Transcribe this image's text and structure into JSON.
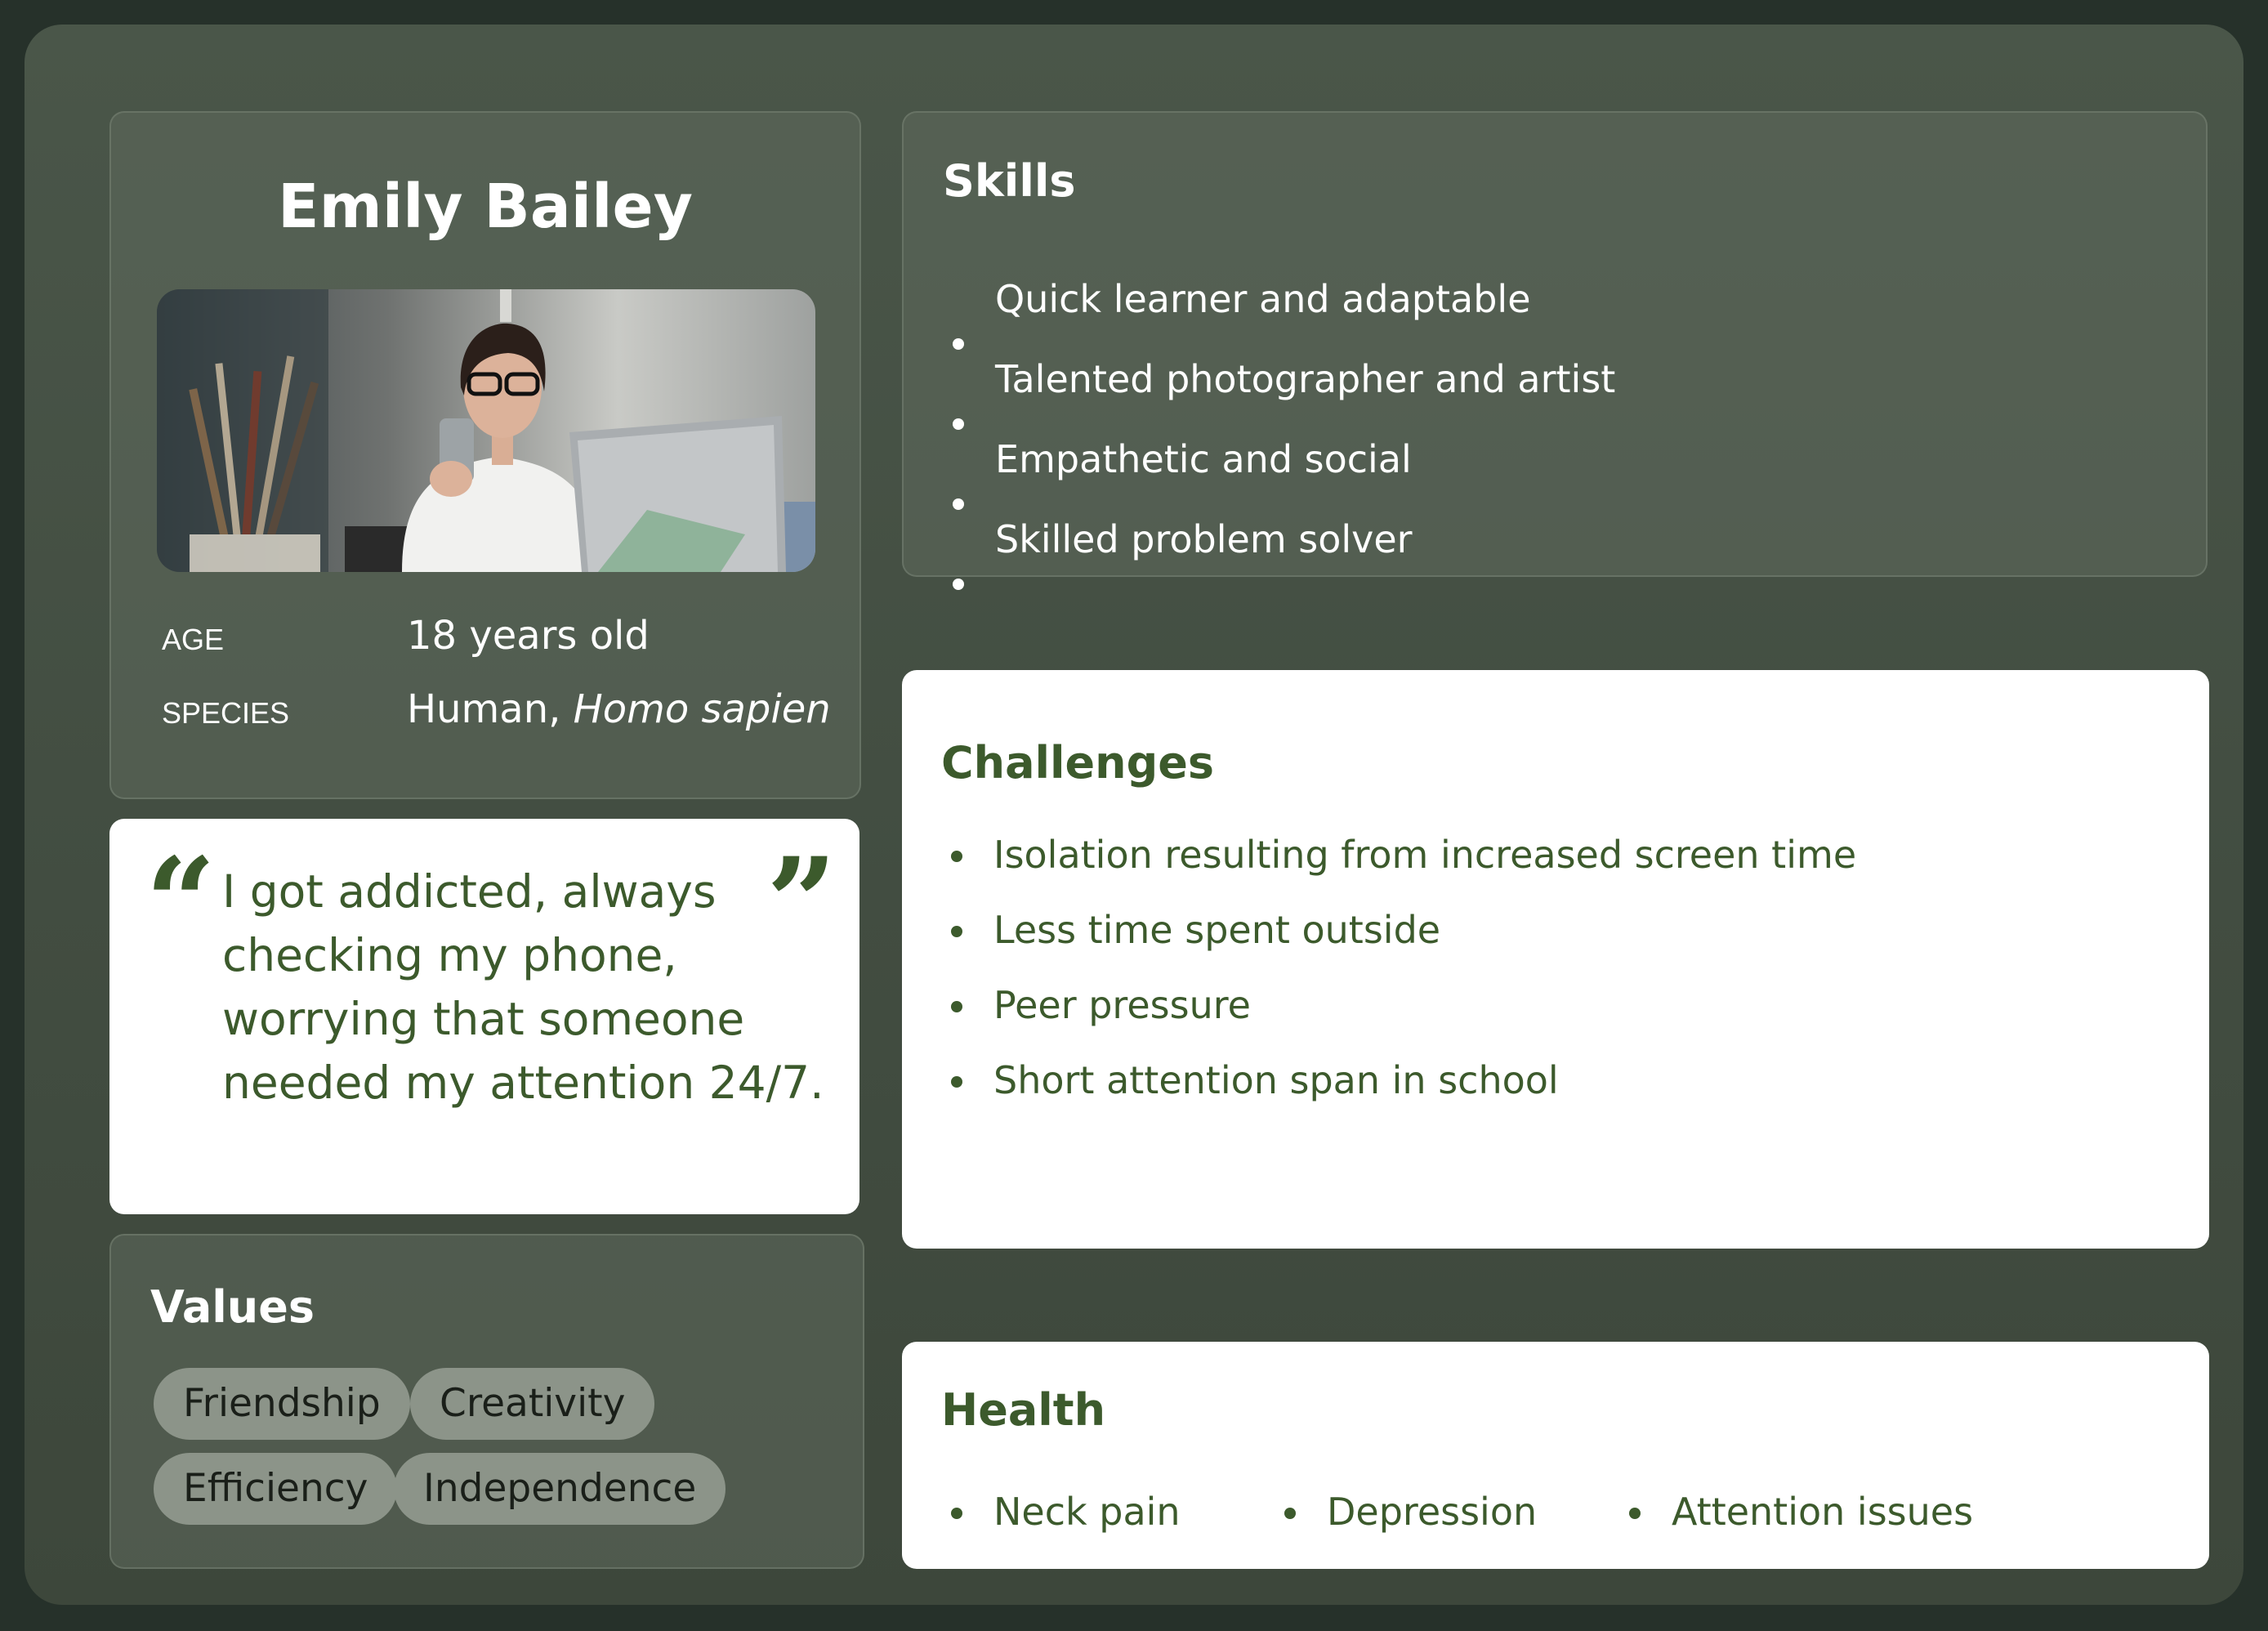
{
  "profile": {
    "name": "Emily Bailey",
    "photo_alt": "Woman with glasses looking at her phone beside a laptop",
    "age_label": "AGE",
    "age_value": "18 years old",
    "species_label": "SPECIES",
    "species_common": "Human, ",
    "species_latin": "Homo sapien"
  },
  "quote": {
    "open_mark": "“",
    "close_mark": "”",
    "text": "I got addicted, always checking my phone, worrying that someone needed my attention 24/7."
  },
  "values": {
    "title": "Values",
    "items": [
      "Friendship",
      "Creativity",
      "Efficiency",
      "Independence"
    ]
  },
  "skills": {
    "title": "Skills",
    "items": [
      "Quick learner and adaptable",
      "Talented photographer and artist",
      "Empathetic and social",
      "Skilled problem solver"
    ]
  },
  "challenges": {
    "title": "Challenges",
    "items": [
      "Isolation resulting from increased screen time",
      "Less time spent outside",
      "Peer pressure",
      "Short attention span in school"
    ]
  },
  "health": {
    "title": "Health",
    "items": [
      "Neck pain",
      "Depression",
      "Attention issues"
    ]
  },
  "colors": {
    "outer_bg": "#26312a",
    "frame_bg": "#4a5649",
    "accent_green": "#3c5a2c",
    "pill_bg": "#8c9489"
  }
}
